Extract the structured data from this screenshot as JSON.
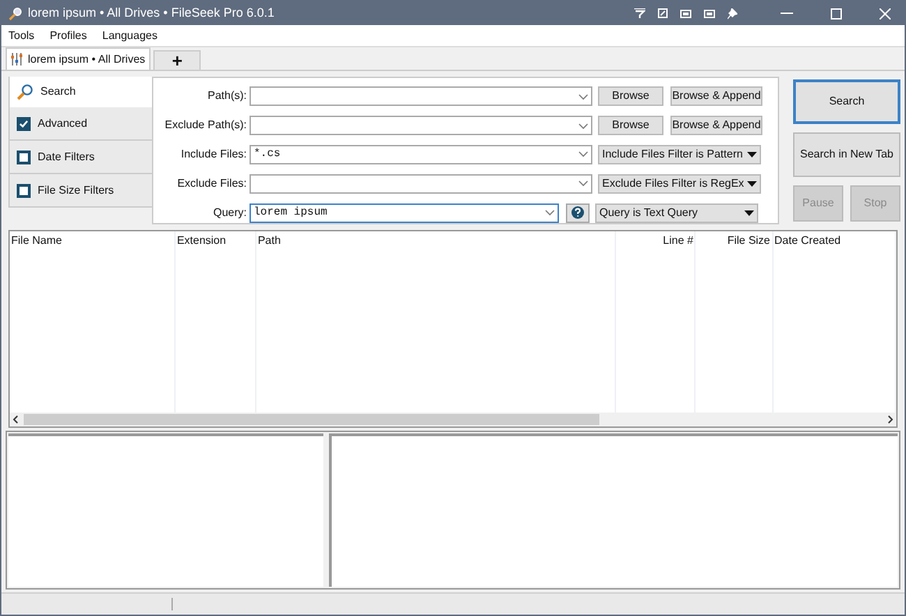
{
  "window": {
    "title": "lorem ipsum • All Drives • FileSeek Pro 6.0.1"
  },
  "menu": [
    "Tools",
    "Profiles",
    "Languages"
  ],
  "tabs": [
    {
      "label": "lorem ipsum • All Drives",
      "selected": true
    }
  ],
  "new_tab": "+",
  "nav": [
    {
      "kind": "link",
      "label": "Search",
      "selected": true
    },
    {
      "kind": "checkbox",
      "label": "Advanced",
      "checked": true,
      "selected": false
    },
    {
      "kind": "checkbox",
      "label": "Date Filters",
      "checked": false,
      "selected": false
    },
    {
      "kind": "checkbox",
      "label": "File Size Filters",
      "checked": false,
      "selected": false
    }
  ],
  "form": [
    {
      "label": "Path(s):",
      "actions": [
        "Browse",
        "Browse & Append"
      ]
    },
    {
      "label": "Exclude Path(s):",
      "actions": [
        "Browse",
        "Browse & Append"
      ]
    },
    {
      "label": "Include Files:",
      "value": "*.cs",
      "mode": "Include Files Filter is Pattern"
    },
    {
      "label": "Exclude Files:",
      "mode": "Exclude Files Filter is RegEx"
    },
    {
      "label": "Query:",
      "value": "lorem ipsum",
      "focused": true,
      "help": true,
      "mode": "Query is Text Query"
    }
  ],
  "buttons": [
    {
      "label": "Search",
      "disabled": false,
      "focused": true
    },
    {
      "label": "Search in New Tab",
      "disabled": false,
      "focused": false
    },
    {
      "label": "Pause",
      "disabled": true,
      "focused": false
    },
    {
      "label": "Stop",
      "disabled": true,
      "focused": false
    }
  ],
  "table": {
    "columns": [
      {
        "label": "File Name",
        "numeric": false
      },
      {
        "label": "Extension",
        "numeric": false
      },
      {
        "label": "Path",
        "numeric": false
      },
      {
        "label": "Line #",
        "numeric": true
      },
      {
        "label": "File Size",
        "numeric": true
      },
      {
        "label": "Date Created",
        "numeric": false
      }
    ]
  }
}
